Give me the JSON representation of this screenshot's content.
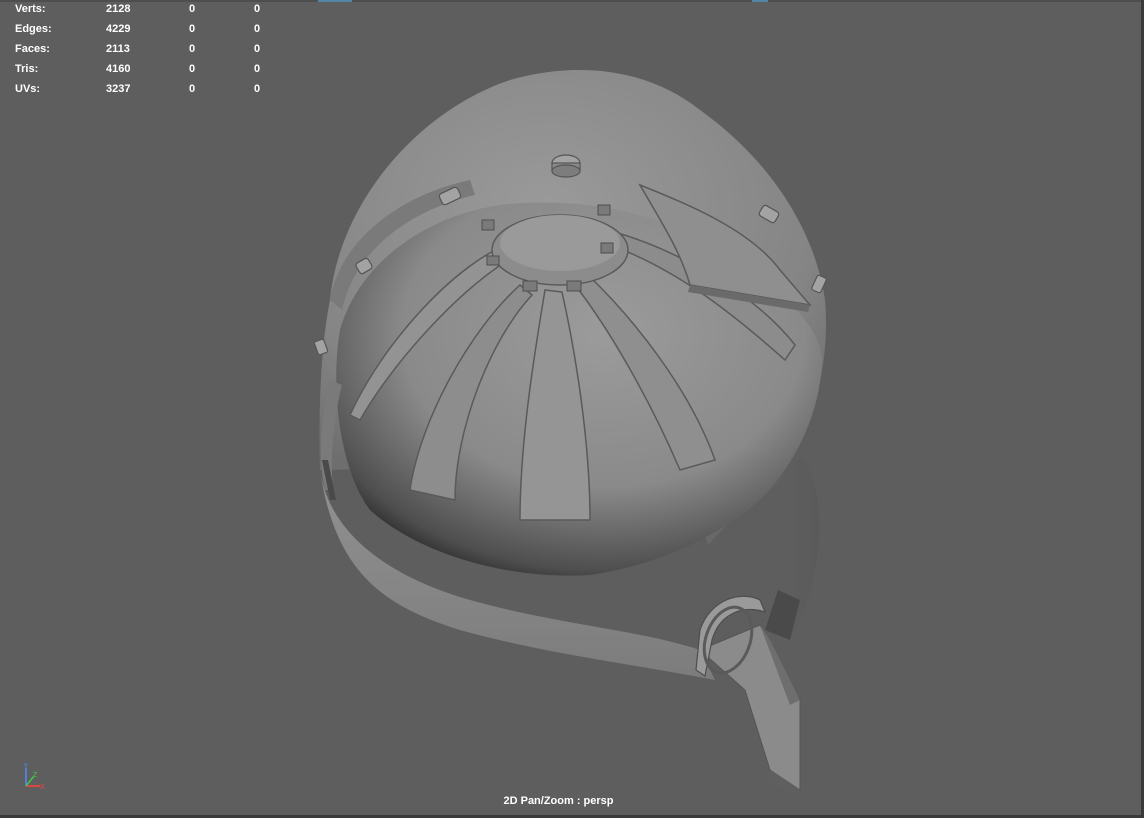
{
  "hud": {
    "rows": [
      {
        "label": "Verts:",
        "total": "2128",
        "selected": "0",
        "components": "0"
      },
      {
        "label": "Edges:",
        "total": "4229",
        "selected": "0",
        "components": "0"
      },
      {
        "label": "Faces:",
        "total": "2113",
        "selected": "0",
        "components": "0"
      },
      {
        "label": "Tris:",
        "total": "4160",
        "selected": "0",
        "components": "0"
      },
      {
        "label": "UVs:",
        "total": "3237",
        "selected": "0",
        "components": "0"
      }
    ]
  },
  "viewport": {
    "camera_label": "2D Pan/Zoom : persp",
    "background_color": "#5e5e5e",
    "model_shade": "#8a8a8a"
  },
  "axis_gizmo": {
    "icon": "axis-gizmo-icon",
    "y_color": "#4d8cff",
    "x_color": "#ff4040",
    "z_color": "#40c840"
  }
}
